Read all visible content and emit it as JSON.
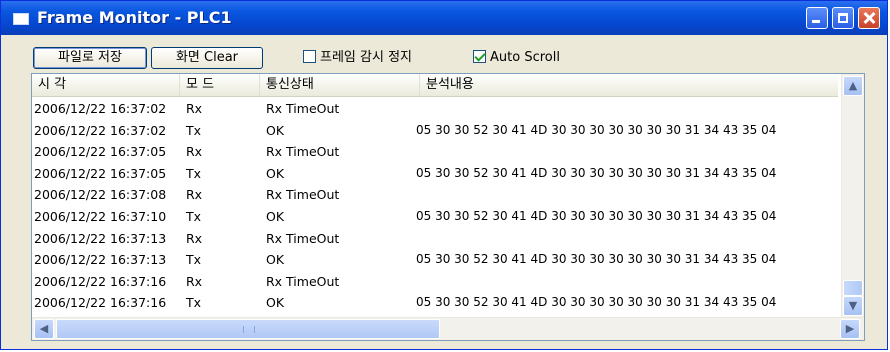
{
  "window": {
    "title": "Frame Monitor - PLC1",
    "icons": {
      "app": "window-icon",
      "minimize": "minimize-icon",
      "maximize": "maximize-icon",
      "close": "close-icon"
    }
  },
  "toolbar": {
    "save_label": "파일로 저장",
    "clear_label": "화면 Clear",
    "stop_monitor_label": "프레임 감시 정지",
    "stop_monitor_checked": false,
    "auto_scroll_label": "Auto Scroll",
    "auto_scroll_checked": true
  },
  "table": {
    "columns": [
      "시 각",
      "모 드",
      "통신상태",
      "분석내용"
    ],
    "rows": [
      {
        "time": "2006/12/22 16:37:02",
        "mode": "Rx",
        "status": "Rx TimeOut",
        "analysis": ""
      },
      {
        "time": "2006/12/22 16:37:02",
        "mode": "Tx",
        "status": "OK",
        "analysis": "05 30 30 52 30 41 4D 30 30 30   30 30 30 30 31 34 43 35 04"
      },
      {
        "time": "2006/12/22 16:37:05",
        "mode": "Rx",
        "status": "Rx TimeOut",
        "analysis": ""
      },
      {
        "time": "2006/12/22 16:37:05",
        "mode": "Tx",
        "status": "OK",
        "analysis": "05 30 30 52 30 41 4D 30 30 30   30 30 30 30 31 34 43 35 04"
      },
      {
        "time": "2006/12/22 16:37:08",
        "mode": "Rx",
        "status": "Rx TimeOut",
        "analysis": ""
      },
      {
        "time": "2006/12/22 16:37:10",
        "mode": "Tx",
        "status": "OK",
        "analysis": "05 30 30 52 30 41 4D 30 30 30   30 30 30 30 31 34 43 35 04"
      },
      {
        "time": "2006/12/22 16:37:13",
        "mode": "Rx",
        "status": "Rx TimeOut",
        "analysis": ""
      },
      {
        "time": "2006/12/22 16:37:13",
        "mode": "Tx",
        "status": "OK",
        "analysis": "05 30 30 52 30 41 4D 30 30 30   30 30 30 30 31 34 43 35 04"
      },
      {
        "time": "2006/12/22 16:37:16",
        "mode": "Rx",
        "status": "Rx TimeOut",
        "analysis": ""
      },
      {
        "time": "2006/12/22 16:37:16",
        "mode": "Tx",
        "status": "OK",
        "analysis": "05 30 30 52 30 41 4D 30 30 30   30 30 30 30 31 34 43 35 04"
      }
    ]
  },
  "scrollbars": {
    "vertical": {
      "up_icon": "chevron-up-icon",
      "down_icon": "chevron-down-icon"
    },
    "horizontal": {
      "left_icon": "chevron-left-icon",
      "right_icon": "chevron-right-icon"
    }
  },
  "colors": {
    "titlebar": "#0a57e0",
    "window_bg": "#ece9d8",
    "checkmark": "#21a121"
  }
}
